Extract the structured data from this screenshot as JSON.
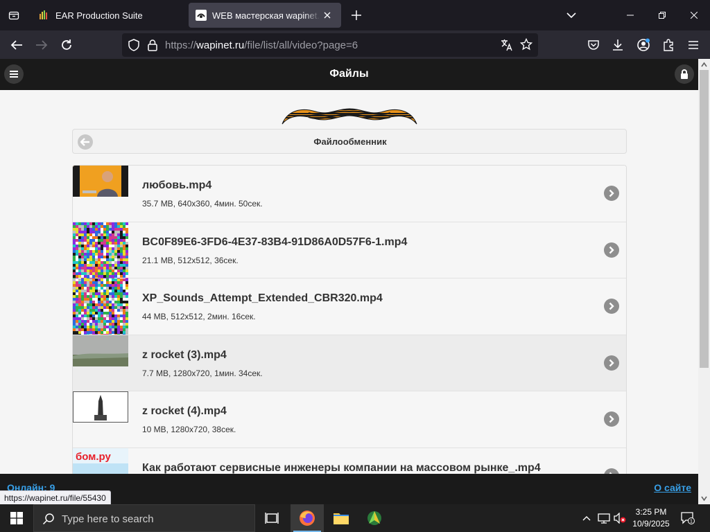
{
  "browser": {
    "tabs": [
      {
        "title": "EAR Production Suite",
        "active": false
      },
      {
        "title": "WEB мастерская wapinet.ru - С",
        "active": true
      }
    ],
    "url": {
      "scheme": "https://",
      "host": "wapinet.ru",
      "path": "/file/list/all/video?page=6"
    },
    "status_url": "https://wapinet.ru/file/55430"
  },
  "site": {
    "header_title": "Файлы",
    "breadcrumb": "Файлообменник",
    "footer": {
      "online": "Онлайн: 9",
      "about": "О сайте"
    }
  },
  "files": [
    {
      "name": "любовь.mp4",
      "meta": "35.7 MB, 640x360, 4мин. 50сек.",
      "thumb": "portrait"
    },
    {
      "name": "BC0F89E6-3FD6-4E37-83B4-91D86A0D57F6-1.mp4",
      "meta": "21.1 MB, 512x512, 36сек.",
      "thumb": "noise"
    },
    {
      "name": "XP_Sounds_Attempt_Extended_CBR320.mp4",
      "meta": "44 MB, 512x512, 2мин. 16сек.",
      "thumb": "noise"
    },
    {
      "name": "z rocket (3).mp4",
      "meta": "7.7 MB, 1280x720, 1мин. 34сек.",
      "thumb": "landscape"
    },
    {
      "name": "z rocket (4).mp4",
      "meta": "10 MB, 1280x720, 38сек.",
      "thumb": "rocket"
    },
    {
      "name": "Как работают сервисные инженеры компании на массовом рынке_.mp4",
      "meta": "",
      "thumb": "logo"
    }
  ],
  "thumb_logo_text": "бом.ру",
  "taskbar": {
    "search_placeholder": "Type here to search",
    "time": "3:25 PM",
    "date": "10/9/2025",
    "notification_count": "1"
  },
  "colors": {
    "accent_link": "#38a0e8",
    "header_bg": "#1a1a1a",
    "page_bg": "#f5f5f5"
  }
}
